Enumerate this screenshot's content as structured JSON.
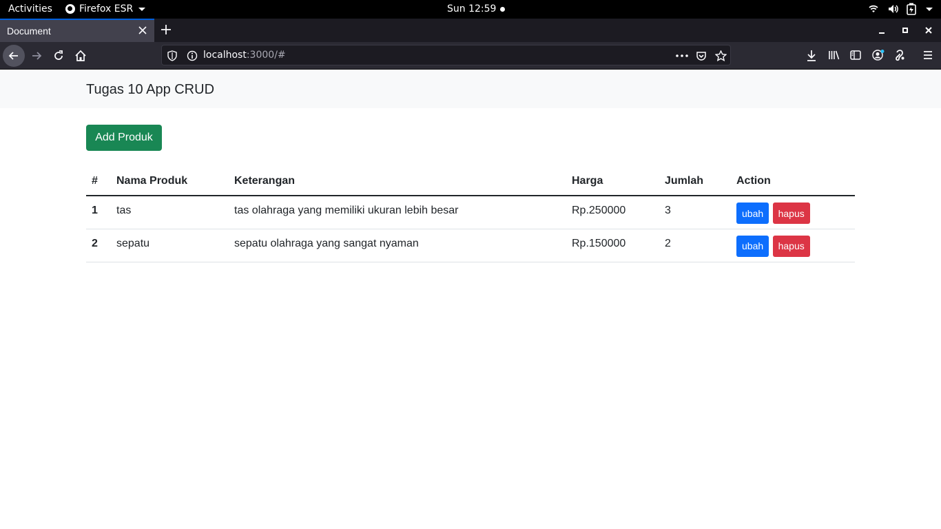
{
  "system_bar": {
    "activities": "Activities",
    "app_name": "Firefox ESR",
    "clock": "Sun 12:59"
  },
  "browser": {
    "tab_title": "Document",
    "url_host": "localhost",
    "url_rest": ":3000/#"
  },
  "page": {
    "brand": "Tugas 10 App CRUD",
    "add_button": "Add Produk",
    "table": {
      "headers": [
        "#",
        "Nama Produk",
        "Keterangan",
        "Harga",
        "Jumlah",
        "Action"
      ],
      "rows": [
        {
          "no": "1",
          "nama": "tas",
          "keterangan": "tas olahraga yang memiliki ukuran lebih besar",
          "harga": "Rp.250000",
          "jumlah": "3",
          "edit": "ubah",
          "delete": "hapus"
        },
        {
          "no": "2",
          "nama": "sepatu",
          "keterangan": "sepatu olahraga yang sangat nyaman",
          "harga": "Rp.150000",
          "jumlah": "2",
          "edit": "ubah",
          "delete": "hapus"
        }
      ]
    }
  },
  "colors": {
    "success": "#198754",
    "primary": "#0d6efd",
    "danger": "#dc3545"
  }
}
